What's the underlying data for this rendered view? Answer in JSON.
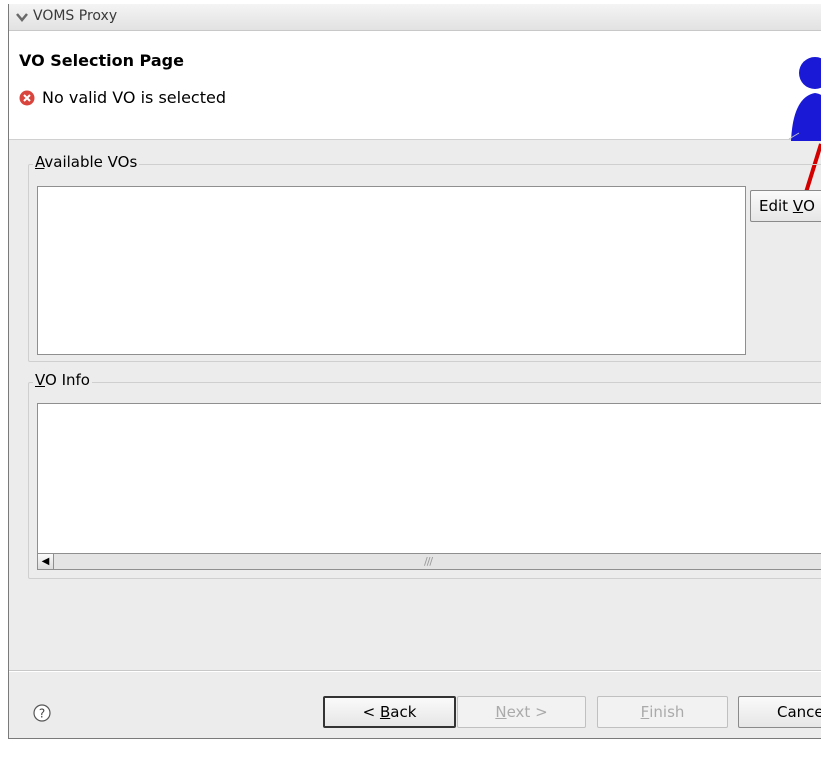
{
  "window": {
    "title": "VOMS Proxy"
  },
  "header": {
    "page_title": "VO Selection Page",
    "error_message": "No valid VO is selected"
  },
  "available_vos": {
    "label_prefix": "",
    "label_mnemonic": "A",
    "label_rest": "vailable VOs",
    "edit_button": {
      "prefix": "Edit ",
      "mnemonic": "V",
      "rest": "O"
    }
  },
  "vo_info": {
    "label_prefix": "",
    "label_mnemonic": "V",
    "label_rest": "O Info"
  },
  "footer": {
    "back": {
      "prefix": "< ",
      "mnemonic": "B",
      "rest": "ack"
    },
    "next": {
      "prefix": "",
      "mnemonic": "N",
      "rest": "ext >"
    },
    "finish": {
      "prefix": "",
      "mnemonic": "F",
      "rest": "inish"
    },
    "cancel": "Cance"
  },
  "colors": {
    "error": "#d9453c",
    "accent_figure": "#1a1ad6",
    "pointer": "#d40000"
  }
}
